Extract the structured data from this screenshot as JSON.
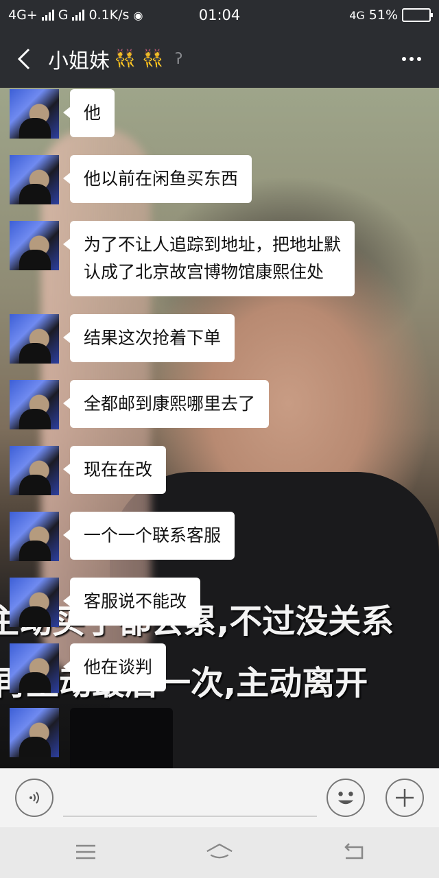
{
  "status_bar": {
    "network_left": "4G+",
    "network_second": "G",
    "speed": "0.1K/s",
    "time": "01:04",
    "network_right": "4G",
    "battery": "51%",
    "battery_level": 0.51
  },
  "header": {
    "title": "小姐妹",
    "emoji": "👯 👯"
  },
  "messages": [
    {
      "text": "他"
    },
    {
      "text": "他以前在闲鱼买东西"
    },
    {
      "text": "为了不让人追踪到地址，把地址默\n认成了北京故宫博物馆康熙住处"
    },
    {
      "text": "结果这次抢着下单"
    },
    {
      "text": "全都邮到康熙哪里去了"
    },
    {
      "text": "现在在改"
    },
    {
      "text": "一个一个联系客服"
    },
    {
      "text": "客服说不能改"
    },
    {
      "text": "他在谈判"
    }
  ],
  "background_caption": {
    "line1": "主动买了都会累,不过没关系",
    "line2": "再主动最后一次,主动离开"
  },
  "icons": {
    "voice": "voice-icon",
    "emoji": "emoji-icon",
    "plus": "plus-icon"
  }
}
